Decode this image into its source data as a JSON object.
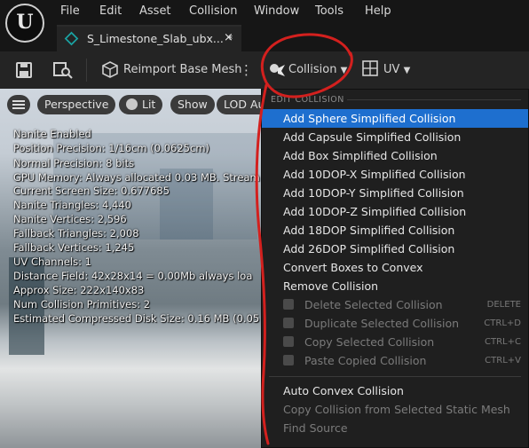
{
  "menubar": {
    "items": [
      "File",
      "Edit",
      "Asset",
      "Collision",
      "Window",
      "Tools",
      "Help"
    ]
  },
  "logo": "U",
  "tab": {
    "title": "S_Limestone_Slab_ubx...",
    "modified": "*",
    "close": "×"
  },
  "toolbar": {
    "reimport_label": "Reimport Base Mesh",
    "more": "⋮",
    "collision_label": "Collision",
    "uv_label": "UV"
  },
  "viewport": {
    "buttons": {
      "perspective": "Perspective",
      "lit": "Lit",
      "show": "Show",
      "lod": "LOD Au"
    },
    "stats": [
      "Nanite Enabled",
      "Position Precision: 1/16cm (0.0625cm)",
      "Normal Precision: 8 bits",
      "GPU Memory: Always allocated 0.03 MB. Stream",
      "Current Screen Size: 0.677685",
      "Nanite Triangles: 4,440",
      "Nanite Vertices: 2,596",
      "Fallback Triangles: 2,008",
      "Fallback Vertices: 1,245",
      "UV Channels: 1",
      "Distance Field: 42x28x14 = 0.00Mb always loa",
      "Approx Size: 222x140x83",
      "Num Collision Primitives: 2",
      "Estimated Compressed Disk Size: 0.16 MB (0.05"
    ]
  },
  "dropdown": {
    "header": "EDIT COLLISION",
    "items": [
      {
        "label": "Add Sphere Simplified Collision",
        "shortcut": ""
      },
      {
        "label": "Add Capsule Simplified Collision",
        "shortcut": ""
      },
      {
        "label": "Add Box Simplified Collision",
        "shortcut": ""
      },
      {
        "label": "Add 10DOP-X Simplified Collision",
        "shortcut": ""
      },
      {
        "label": "Add 10DOP-Y Simplified Collision",
        "shortcut": ""
      },
      {
        "label": "Add 10DOP-Z Simplified Collision",
        "shortcut": ""
      },
      {
        "label": "Add 18DOP Simplified Collision",
        "shortcut": ""
      },
      {
        "label": "Add 26DOP Simplified Collision",
        "shortcut": ""
      },
      {
        "label": "Convert Boxes to Convex",
        "shortcut": ""
      },
      {
        "label": "Remove Collision",
        "shortcut": ""
      },
      {
        "label": "Delete Selected Collision",
        "shortcut": "DELETE"
      },
      {
        "label": "Duplicate Selected Collision",
        "shortcut": "CTRL+D"
      },
      {
        "label": "Copy Selected Collision",
        "shortcut": "CTRL+C"
      },
      {
        "label": "Paste Copied Collision",
        "shortcut": "CTRL+V"
      },
      {
        "label": "Auto Convex Collision",
        "shortcut": ""
      },
      {
        "label": "Copy Collision from Selected Static Mesh",
        "shortcut": ""
      },
      {
        "label": "Find Source",
        "shortcut": ""
      }
    ]
  },
  "colors": {
    "highlight": "#1e6fcf",
    "annotation": "#d3201e",
    "accent_teal": "#1aa3a3"
  }
}
